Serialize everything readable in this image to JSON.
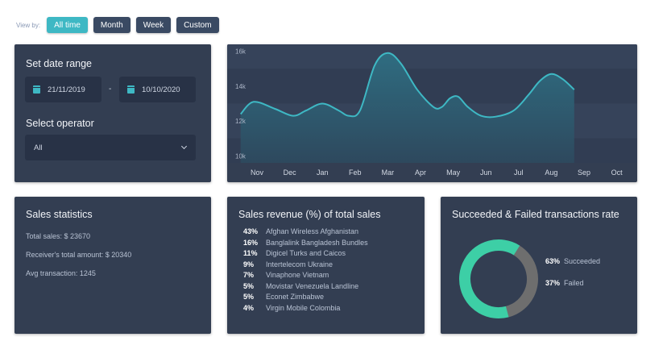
{
  "view_by": {
    "label": "View by:",
    "buttons": [
      {
        "label": "All time",
        "active": true
      },
      {
        "label": "Month",
        "active": false
      },
      {
        "label": "Week",
        "active": false
      },
      {
        "label": "Custom",
        "active": false
      }
    ]
  },
  "date_range": {
    "title": "Set date range",
    "from": "21/11/2019",
    "separator": "-",
    "to": "10/10/2020",
    "operator_title": "Select operator",
    "operator_value": "All"
  },
  "chart_data": {
    "type": "area",
    "x": [
      "Nov",
      "Dec",
      "Jan",
      "Feb",
      "Mar",
      "Apr",
      "May",
      "Jun",
      "Jul",
      "Aug",
      "Sep",
      "Oct"
    ],
    "y_ticks": [
      "16k",
      "14k",
      "12k",
      "10k"
    ],
    "ylim": [
      9600,
      16400
    ],
    "points": [
      [
        -0.5,
        12400
      ],
      [
        -0.1,
        13100
      ],
      [
        0.55,
        12700
      ],
      [
        1.1,
        12300
      ],
      [
        1.5,
        12600
      ],
      [
        2.0,
        13000
      ],
      [
        2.5,
        12600
      ],
      [
        2.8,
        12300
      ],
      [
        3.15,
        12600
      ],
      [
        3.6,
        15200
      ],
      [
        4.0,
        15900
      ],
      [
        4.4,
        15300
      ],
      [
        4.9,
        13800
      ],
      [
        5.4,
        12800
      ],
      [
        5.65,
        12800
      ],
      [
        5.9,
        13300
      ],
      [
        6.15,
        13400
      ],
      [
        6.45,
        12800
      ],
      [
        6.85,
        12300
      ],
      [
        7.3,
        12250
      ],
      [
        7.85,
        12600
      ],
      [
        8.3,
        13500
      ],
      [
        8.65,
        14300
      ],
      [
        9.0,
        14700
      ],
      [
        9.35,
        14400
      ],
      [
        9.7,
        13800
      ]
    ],
    "colors": {
      "line": "#3eb8c4",
      "fill_top": "#2f6f83",
      "fill_bottom": "#2d4a5f"
    }
  },
  "sales_statistics": {
    "title": "Sales statistics",
    "total_sales": "Total sales: $ 23670",
    "receivers_total": "Receiver's total amount: $ 20340",
    "avg_transaction": "Avg transaction: 1245"
  },
  "sales_revenue": {
    "title": "Sales revenue (%) of total sales",
    "rows": [
      {
        "pct": "43%",
        "name": "Afghan Wireless Afghanistan"
      },
      {
        "pct": "16%",
        "name": "Banglalink Bangladesh Bundles"
      },
      {
        "pct": "11%",
        "name": "Digicel Turks and Caicos"
      },
      {
        "pct": "9%",
        "name": "Intertelecom Ukraine"
      },
      {
        "pct": "7%",
        "name": "Vinaphone Vietnam"
      },
      {
        "pct": "5%",
        "name": "Movistar Venezuela Landline"
      },
      {
        "pct": "5%",
        "name": "Econet Zimbabwe"
      },
      {
        "pct": "4%",
        "name": "Virgin Mobile Colombia"
      }
    ]
  },
  "transactions": {
    "title": "Succeeded & Failed transactions rate",
    "succeeded_pct": "63%",
    "succeeded_label": "Succeeded",
    "failed_pct": "37%",
    "failed_label": "Failed",
    "succeeded_fraction": 0.63,
    "failed_fraction": 0.37,
    "succeeded_color": "#3dcfa6",
    "failed_color": "#6e6e6e"
  }
}
